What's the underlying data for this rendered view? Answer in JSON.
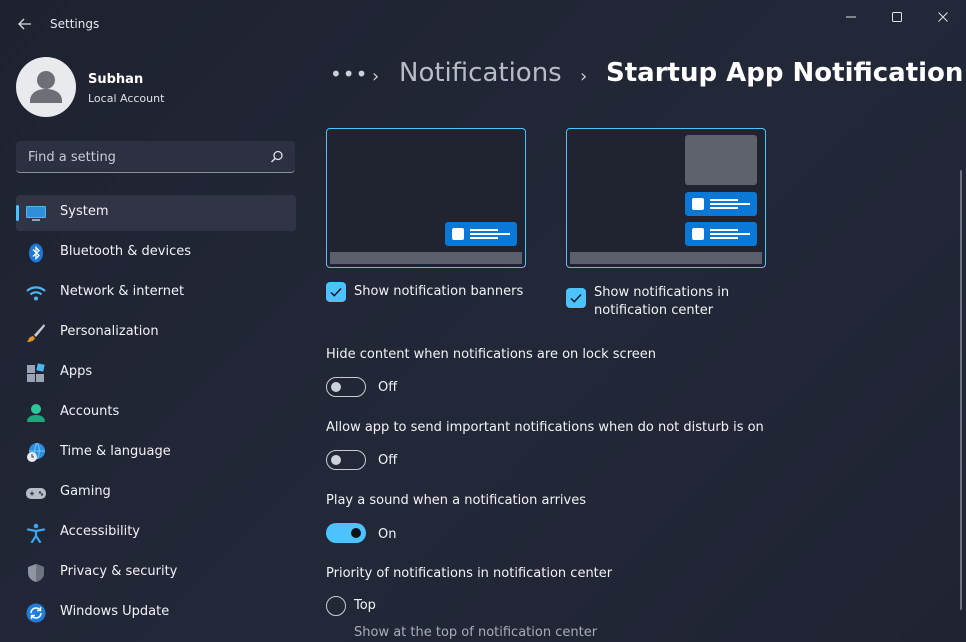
{
  "window": {
    "title": "Settings"
  },
  "profile": {
    "name": "Subhan",
    "account_type": "Local Account"
  },
  "search": {
    "placeholder": "Find a setting"
  },
  "sidebar": {
    "items": [
      {
        "label": "System",
        "icon": "monitor-icon",
        "active": true
      },
      {
        "label": "Bluetooth & devices",
        "icon": "bluetooth-icon"
      },
      {
        "label": "Network & internet",
        "icon": "wifi-icon"
      },
      {
        "label": "Personalization",
        "icon": "paintbrush-icon"
      },
      {
        "label": "Apps",
        "icon": "apps-icon"
      },
      {
        "label": "Accounts",
        "icon": "person-icon"
      },
      {
        "label": "Time & language",
        "icon": "globe-clock-icon"
      },
      {
        "label": "Gaming",
        "icon": "gamepad-icon"
      },
      {
        "label": "Accessibility",
        "icon": "accessibility-icon"
      },
      {
        "label": "Privacy & security",
        "icon": "shield-icon"
      },
      {
        "label": "Windows Update",
        "icon": "update-icon"
      }
    ]
  },
  "breadcrumb": {
    "more": "•••",
    "separator": "›",
    "parent": "Notifications",
    "current": "Startup App Notification"
  },
  "banners": {
    "label": "Show notification banners",
    "checked": true
  },
  "center": {
    "label_line1": "Show notifications in",
    "label_line2": "notification center",
    "checked": true
  },
  "settings": {
    "hide_content": {
      "label": "Hide content when notifications are on lock screen",
      "state": "Off"
    },
    "dnd": {
      "label": "Allow app to send important notifications when do not disturb is on",
      "state": "Off"
    },
    "sound": {
      "label": "Play a sound when a notification arrives",
      "state": "On"
    }
  },
  "priority": {
    "label": "Priority of notifications in notification center",
    "option_top": {
      "label": "Top",
      "description": "Show at the top of notification center"
    }
  },
  "colors": {
    "accent": "#4cc2ff",
    "toast_blue": "#0a78d4",
    "background": "#202434"
  }
}
